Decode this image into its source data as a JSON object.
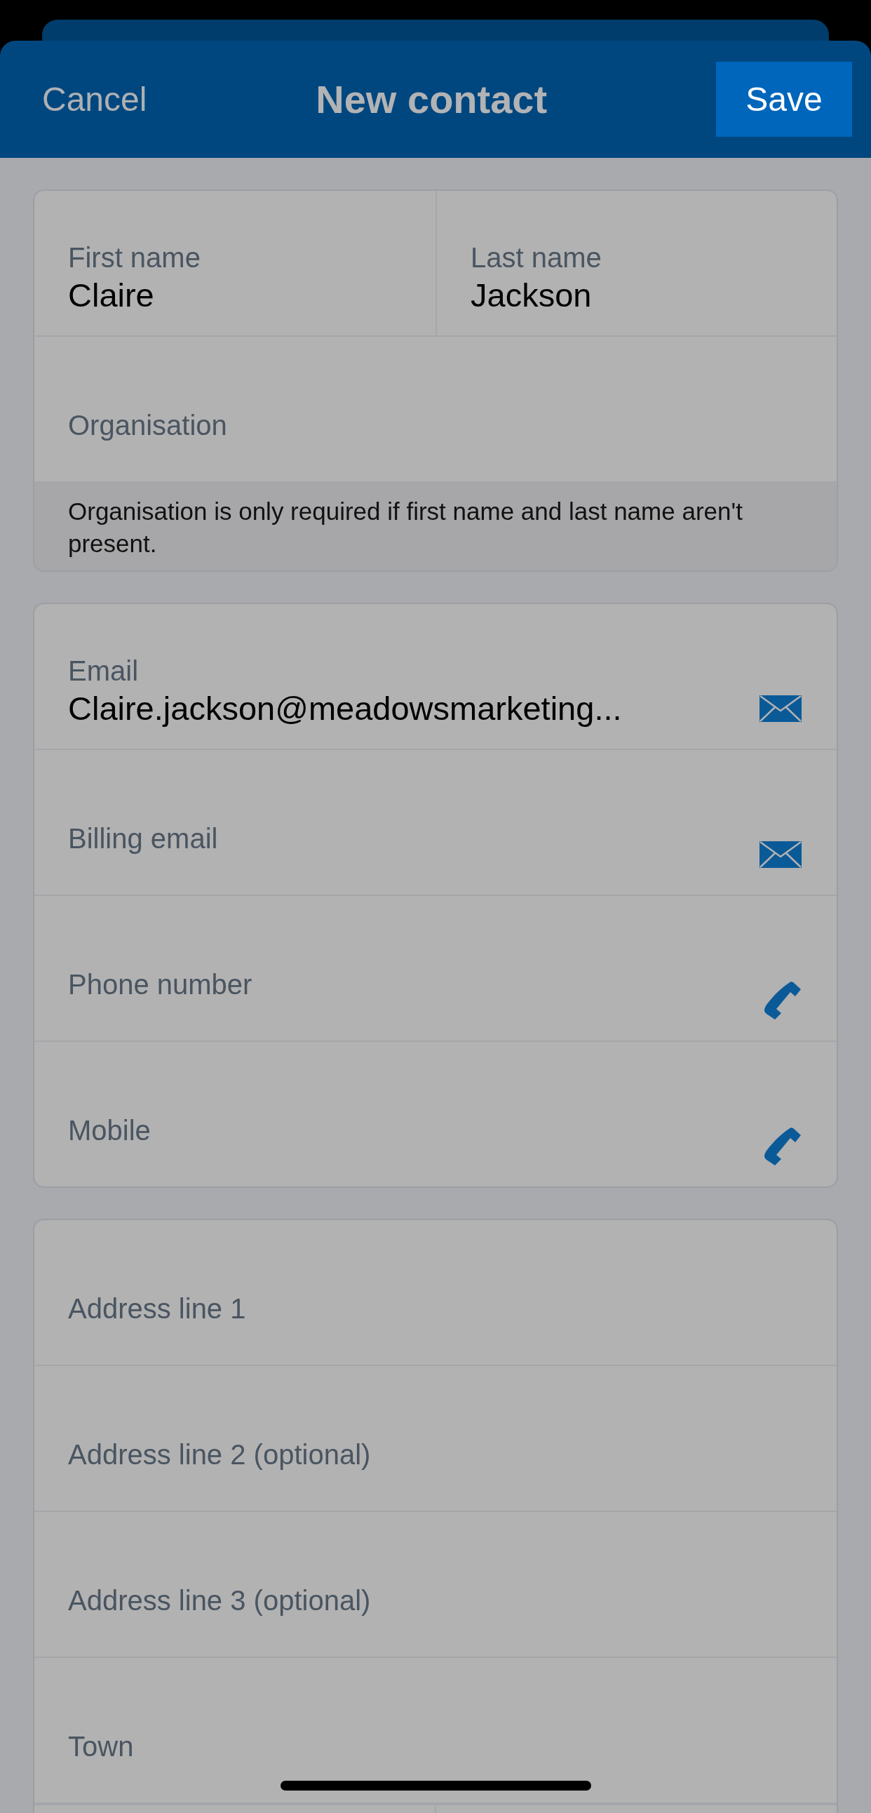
{
  "header": {
    "cancel": "Cancel",
    "title": "New contact",
    "save": "Save"
  },
  "sections": [
    {
      "rows": [
        {
          "kind": "split",
          "fields": [
            {
              "kind": "text",
              "label": "First name",
              "value": "Claire"
            },
            {
              "kind": "text",
              "label": "Last name",
              "value": "Jackson"
            }
          ]
        },
        {
          "kind": "single",
          "fields": [
            {
              "kind": "text",
              "label": "Organisation"
            }
          ]
        },
        {
          "kind": "note",
          "text": "Organisation is only required if first name and last name aren't present."
        }
      ]
    },
    {
      "rows": [
        {
          "kind": "single",
          "fields": [
            {
              "kind": "email",
              "label": "Email",
              "value": "Claire.jackson@meadowsmarketing..."
            }
          ]
        },
        {
          "kind": "single",
          "fields": [
            {
              "kind": "email",
              "label": "Billing email"
            }
          ]
        },
        {
          "kind": "single",
          "fields": [
            {
              "kind": "phone",
              "label": "Phone number"
            }
          ]
        },
        {
          "kind": "single",
          "fields": [
            {
              "kind": "phone",
              "label": "Mobile"
            }
          ]
        }
      ]
    },
    {
      "rows": [
        {
          "kind": "single",
          "fields": [
            {
              "kind": "text",
              "label": "Address line 1"
            }
          ]
        },
        {
          "kind": "single",
          "fields": [
            {
              "kind": "text",
              "label": "Address line 2 (optional)"
            }
          ]
        },
        {
          "kind": "single",
          "fields": [
            {
              "kind": "text",
              "label": "Address line 3 (optional)"
            }
          ]
        },
        {
          "kind": "single",
          "fields": [
            {
              "kind": "text",
              "label": "Town"
            }
          ]
        }
      ]
    }
  ]
}
